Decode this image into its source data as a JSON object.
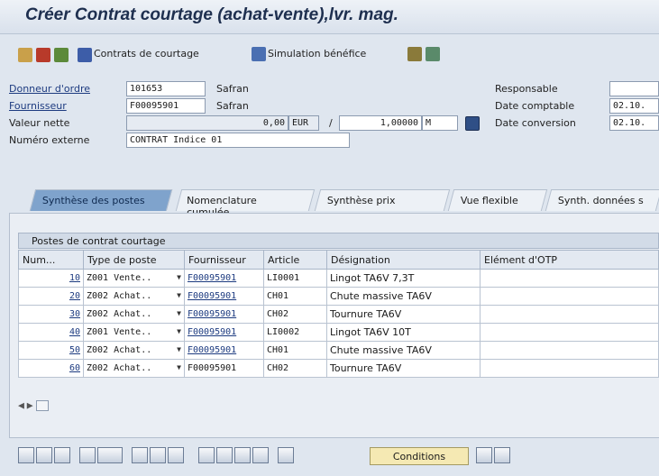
{
  "window": {
    "title": "Créer Contrat courtage (achat-vente),lvr. mag."
  },
  "toolbar": {
    "contracts_label": "Contrats de courtage",
    "simulation_label": "Simulation bénéfice"
  },
  "form": {
    "donneur_label": "Donneur d'ordre",
    "donneur_value": "101653",
    "donneur_name": "Safran",
    "fournisseur_label": "Fournisseur",
    "fournisseur_value": "F00095901",
    "fournisseur_name": "Safran",
    "valeur_label": "Valeur nette",
    "valeur_value": "0,00",
    "currency": "EUR",
    "ratio_sep": "/",
    "ratio_value": "1,00000",
    "ratio_unit": "M",
    "externe_label": "Numéro externe",
    "externe_value": "CONTRAT Indice 01",
    "responsable_label": "Responsable",
    "responsable_value": "",
    "date_compt_label": "Date comptable",
    "date_compt_value": "02.10.",
    "date_conv_label": "Date conversion",
    "date_conv_value": "02.10."
  },
  "tabs": [
    "Synthèse des postes",
    "Nomenclature cumulée",
    "Synthèse prix",
    "Vue flexible",
    "Synth. données s"
  ],
  "grid": {
    "caption": "Postes de contrat courtage",
    "headers": [
      "Num...",
      "Type de poste",
      "Fournisseur",
      "Article",
      "Désignation",
      "Elément d'OTP"
    ],
    "rows": [
      [
        "10",
        "Z001 Vente..",
        "F00095901",
        "LI0001",
        "Lingot TA6V 7,3T",
        ""
      ],
      [
        "20",
        "Z002 Achat..",
        "F00095901",
        "CH01",
        "Chute massive TA6V",
        ""
      ],
      [
        "30",
        "Z002 Achat..",
        "F00095901",
        "CH02",
        "Tournure TA6V",
        ""
      ],
      [
        "40",
        "Z001 Vente..",
        "F00095901",
        "LI0002",
        "Lingot TA6V 10T",
        ""
      ],
      [
        "50",
        "Z002 Achat..",
        "F00095901",
        "CH01",
        "Chute massive TA6V",
        ""
      ],
      [
        "60",
        "Z002 Achat..",
        "F00095901",
        "CH02",
        "Tournure TA6V",
        ""
      ]
    ]
  },
  "bottom": {
    "conditions_label": "Conditions"
  }
}
